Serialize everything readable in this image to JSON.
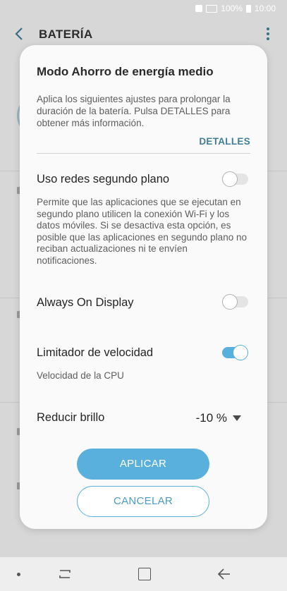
{
  "status_bar": {
    "battery_text": "100%",
    "time": "10:00"
  },
  "header": {
    "title": "BATERÍA"
  },
  "dialog": {
    "title": "Modo Ahorro de energía medio",
    "description": "Aplica los siguientes ajustes para prolongar la duración de la batería. Pulsa DETALLES para obtener más información.",
    "details_label": "DETALLES",
    "settings": {
      "background_data": {
        "label": "Uso redes segundo plano",
        "description": "Permite que las aplicaciones que se ejecutan en segundo plano utilicen la conexión Wi-Fi y los datos móviles. Si se desactiva esta opción, es posible que las aplicaciones en segundo plano no reciban actualizaciones ni te envíen notificaciones.",
        "enabled": false
      },
      "always_on_display": {
        "label": "Always On Display",
        "enabled": false
      },
      "speed_limiter": {
        "label": "Limitador de velocidad",
        "description": "Velocidad de la CPU",
        "enabled": true
      },
      "reduce_brightness": {
        "label": "Reducir brillo",
        "value": "-10 %"
      }
    },
    "apply_label": "APLICAR",
    "cancel_label": "CANCELAR"
  },
  "colors": {
    "accent": "#5ab0dd",
    "link": "#3f7e96",
    "scrim": "#d7d7d7"
  }
}
